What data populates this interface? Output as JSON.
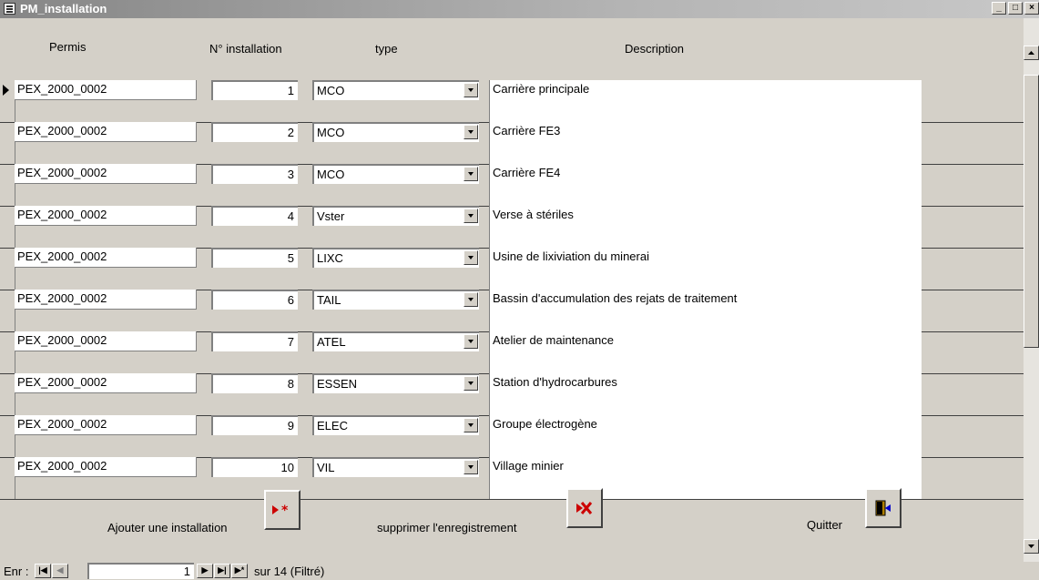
{
  "window": {
    "title": "PM_installation",
    "minimize": "_",
    "maximize": "□",
    "close": "×"
  },
  "columns": {
    "permis": "Permis",
    "num": "N° installation",
    "type": "type",
    "description": "Description"
  },
  "rows": [
    {
      "permis": "PEX_2000_0002",
      "num": "1",
      "type": "MCO",
      "description": "Carrière principale"
    },
    {
      "permis": "PEX_2000_0002",
      "num": "2",
      "type": "MCO",
      "description": "Carrière FE3"
    },
    {
      "permis": "PEX_2000_0002",
      "num": "3",
      "type": "MCO",
      "description": "Carrière FE4"
    },
    {
      "permis": "PEX_2000_0002",
      "num": "4",
      "type": "Vster",
      "description": "Verse à stériles"
    },
    {
      "permis": "PEX_2000_0002",
      "num": "5",
      "type": "LIXC",
      "description": "Usine de lixiviation du minerai"
    },
    {
      "permis": "PEX_2000_0002",
      "num": "6",
      "type": "TAIL",
      "description": "Bassin d'accumulation des rejats de traitement"
    },
    {
      "permis": "PEX_2000_0002",
      "num": "7",
      "type": "ATEL",
      "description": "Atelier de maintenance"
    },
    {
      "permis": "PEX_2000_0002",
      "num": "8",
      "type": "ESSEN",
      "description": "Station d'hydrocarbures"
    },
    {
      "permis": "PEX_2000_0002",
      "num": "9",
      "type": "ELEC",
      "description": "Groupe électrogène"
    },
    {
      "permis": "PEX_2000_0002",
      "num": "10",
      "type": "VIL",
      "description": "Village minier"
    }
  ],
  "footer": {
    "add_label": "Ajouter une installation",
    "delete_label": "supprimer l'enregistrement",
    "quit_label": "Quitter"
  },
  "nav": {
    "label": "Enr :",
    "current": "1",
    "total_text": "sur  14 (Filtré)"
  },
  "colors": {
    "add_icon": "#cc0000",
    "delete_icon": "#cc0000",
    "quit_icon": "#b08000"
  }
}
